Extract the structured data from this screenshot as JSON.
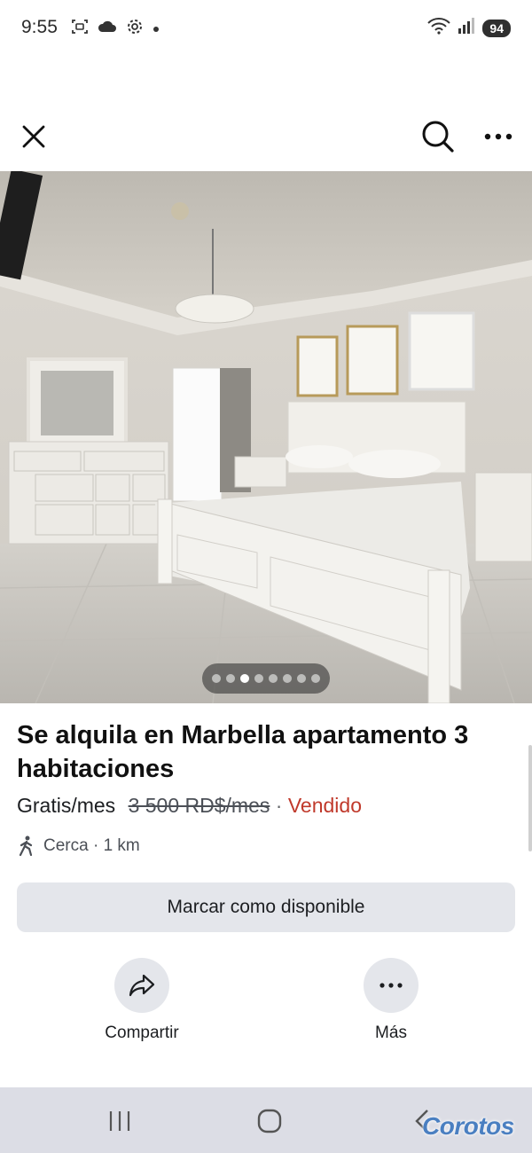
{
  "status_bar": {
    "time": "9:55",
    "battery": "94",
    "icons": [
      "screenshot-icon",
      "cloud-icon",
      "settings-icon",
      "dot-icon",
      "wifi-icon",
      "signal-icon"
    ]
  },
  "top_bar": {
    "icons": [
      "close-icon",
      "search-icon",
      "more-icon"
    ]
  },
  "photo": {
    "description_icon": "bedroom-photo",
    "pager": {
      "count": 8,
      "active_index": 2
    }
  },
  "listing": {
    "title": "Se alquila en Marbella apartamento 3 habitaciones",
    "price": "Gratis/mes",
    "old_price": "3 500 RD$/mes",
    "separator": "·",
    "status": "Vendido",
    "distance": "Cerca · 1 km"
  },
  "actions": {
    "cta_label": "Marcar como disponible",
    "share_label": "Compartir",
    "more_label": "Más"
  },
  "watermark": "Corotos",
  "colors": {
    "sold": "#c0392b",
    "button_bg": "#e4e6eb",
    "watermark": "#4a7fc1",
    "navbar_bg": "#dcdde5"
  }
}
